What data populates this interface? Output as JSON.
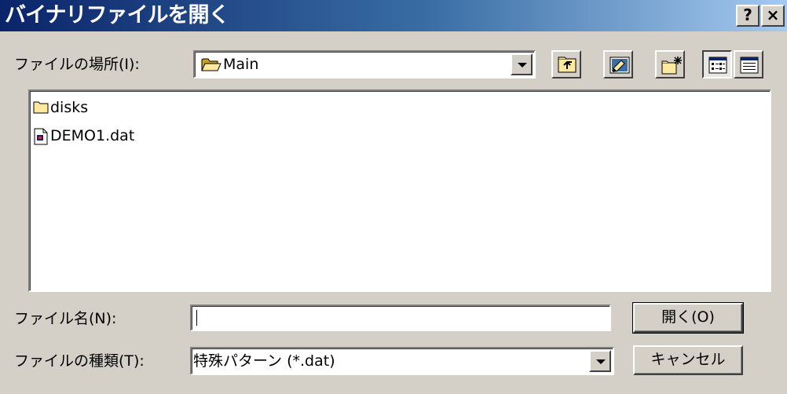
{
  "window": {
    "title": "バイナリファイルを開く",
    "help_button": "?",
    "close_button": "×"
  },
  "location": {
    "label": "ファイルの場所(I):",
    "value": "Main",
    "icon": "folder-open-icon"
  },
  "toolbar": {
    "buttons": [
      {
        "name": "up-one-level",
        "icon": "folder-up-icon"
      },
      {
        "name": "desktop",
        "icon": "desktop-icon"
      },
      {
        "name": "new-folder",
        "icon": "new-folder-icon"
      },
      {
        "name": "list-view",
        "icon": "list-view-icon",
        "pressed": true
      },
      {
        "name": "details-view",
        "icon": "details-view-icon"
      }
    ]
  },
  "file_list": {
    "items": [
      {
        "label": "disks",
        "icon": "folder-icon"
      },
      {
        "label": "DEMO1.dat",
        "icon": "data-file-icon"
      }
    ]
  },
  "filename": {
    "label": "ファイル名(N):",
    "value": ""
  },
  "filetype": {
    "label": "ファイルの種類(T):",
    "value": "特殊パターン (*.dat)"
  },
  "buttons": {
    "open": "開く(O)",
    "cancel": "キャンセル"
  },
  "colors": {
    "title_gradient_start": "#0a246a",
    "title_gradient_end": "#a6caf0",
    "face": "#d4d0c8",
    "folder_yellow": "#ffe99e"
  }
}
